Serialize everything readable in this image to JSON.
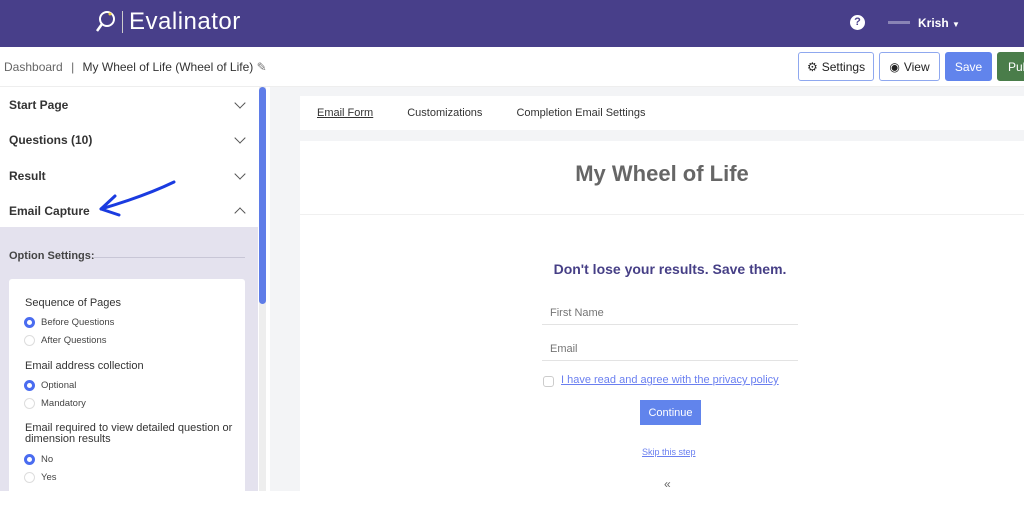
{
  "header": {
    "brand": "Evalinator",
    "user": "Krish",
    "help_icon": "question-circle-icon"
  },
  "breadcrumb": {
    "root": "Dashboard",
    "separator": "|",
    "current": "My Wheel of Life (Wheel of Life)"
  },
  "toolbar": {
    "settings": "Settings",
    "view": "View",
    "save": "Save",
    "publish": "Pub"
  },
  "sidebar": {
    "items": [
      {
        "label": "Start Page"
      },
      {
        "label": "Questions (10)"
      },
      {
        "label": "Result"
      },
      {
        "label": "Email Capture"
      }
    ],
    "option_settings": "Option Settings:",
    "groups": [
      {
        "label": "Sequence of Pages",
        "options": [
          "Before Questions",
          "After Questions"
        ],
        "selected": "Before Questions"
      },
      {
        "label": "Email address collection",
        "options": [
          "Optional",
          "Mandatory"
        ],
        "selected": "Optional"
      },
      {
        "label": "Email required to view detailed question or dimension results",
        "options": [
          "No",
          "Yes"
        ],
        "selected": "No"
      }
    ]
  },
  "tabs": [
    "Email Form",
    "Customizations",
    "Completion Email Settings"
  ],
  "form": {
    "title": "My Wheel of Life",
    "heading": "Don't lose your results. Save them.",
    "first_name_placeholder": "First Name",
    "email_placeholder": "Email",
    "privacy": "I have read and agree with the privacy policy",
    "continue": "Continue",
    "skip": "Skip this step",
    "back": "«"
  },
  "colors": {
    "header": "#483f8a",
    "primary": "#6184ec",
    "publish": "#4a7d4a"
  }
}
